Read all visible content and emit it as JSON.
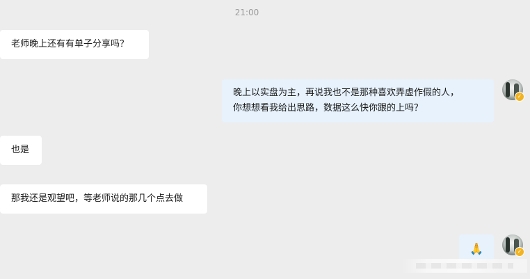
{
  "chat": {
    "timestamp": "21:00",
    "messages": [
      {
        "side": "in",
        "lines": [
          "老师晚上还有有单子分享吗？"
        ]
      },
      {
        "side": "out",
        "lines": [
          "晚上以实盘为主，再说我也不是那种喜欢弄虚作假的人，",
          "你想想看我给出思路，数据这么快你跟的上吗？"
        ]
      },
      {
        "side": "in",
        "lines": [
          "也是"
        ]
      },
      {
        "side": "in",
        "lines": [
          "那我还是观望吧，等老师说的那几个点去做"
        ]
      },
      {
        "side": "out",
        "lines": [
          "🙏"
        ]
      }
    ]
  },
  "avatar": {
    "badge_icon": "vip-badge-icon",
    "badge_color": "#f2b322"
  },
  "colors": {
    "background": "#ededed",
    "incoming_bubble": "#ffffff",
    "outgoing_bubble": "#e7f2fc"
  }
}
